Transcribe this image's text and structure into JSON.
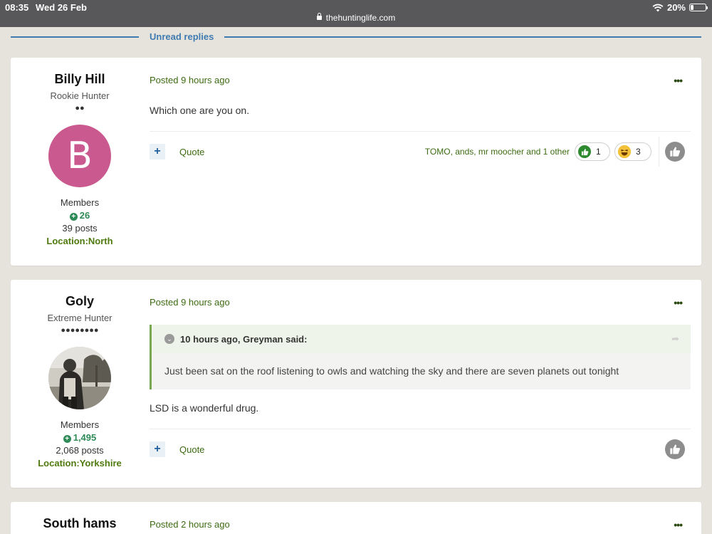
{
  "status_bar": {
    "time": "08:35",
    "date": "Wed 26 Feb",
    "url": "thehuntinglife.com",
    "battery": "20%"
  },
  "unread_label": "Unread replies",
  "colors": {
    "accent_blue": "#3f7bb0",
    "green_text": "#3d6b12",
    "rep_green": "#2e8a57",
    "avatar_b": "#c9598f"
  },
  "posts": [
    {
      "author": {
        "name": "Billy Hill",
        "rank": "Rookie Hunter",
        "pips": "●●",
        "avatar_letter": "B",
        "group": "Members",
        "reputation": "26",
        "post_count": "39 posts",
        "location": "Location:North"
      },
      "posted": "Posted 9 hours ago",
      "body": "Which one are you on.",
      "quote_label": "Quote",
      "likers": "TOMO, ands, mr moocher and 1 other",
      "reactions": [
        {
          "icon": "thumbs-up-icon",
          "count": "1"
        },
        {
          "icon": "laugh-icon",
          "count": "3"
        }
      ]
    },
    {
      "author": {
        "name": "Goly",
        "rank": "Extreme Hunter",
        "pips": "●●●●●●●●",
        "avatar_icon": "photo-avatar",
        "group": "Members",
        "reputation": "1,495",
        "post_count": "2,068 posts",
        "location": "Location:Yorkshire"
      },
      "posted": "Posted 9 hours ago",
      "quote": {
        "citation": "10 hours ago, Greyman said:",
        "text": "Just been sat on the roof listening to owls and watching the sky and there are seven planets out tonight"
      },
      "body": "LSD is a wonderful drug.",
      "quote_label": "Quote"
    },
    {
      "author": {
        "name": "South hams"
      },
      "posted": "Posted 2 hours ago"
    }
  ]
}
